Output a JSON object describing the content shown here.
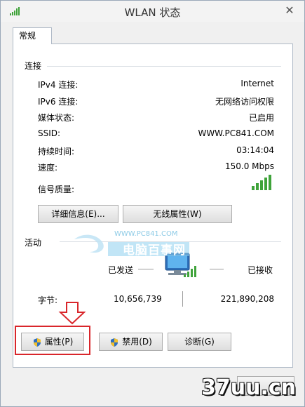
{
  "window": {
    "title": "WLAN 状态",
    "close_glyph": "✕"
  },
  "tabs": [
    {
      "label": "常规"
    }
  ],
  "connection": {
    "section_title": "连接",
    "rows": [
      {
        "label": "IPv4 连接:",
        "value": "Internet"
      },
      {
        "label": "IPv6 连接:",
        "value": "无网络访问权限"
      },
      {
        "label": "媒体状态:",
        "value": "已启用"
      },
      {
        "label": "SSID:",
        "value": "WWW.PC841.COM"
      },
      {
        "label": "持续时间:",
        "value": "03:14:04"
      },
      {
        "label": "速度:",
        "value": "150.0 Mbps"
      }
    ],
    "signal_label": "信号质量:",
    "signal_bars": 5,
    "buttons": {
      "details": "详细信息(E)...",
      "wireless_props": "无线属性(W)"
    }
  },
  "activity": {
    "section_title": "活动",
    "sent_label": "已发送",
    "received_label": "已接收",
    "bytes_label": "字节:",
    "sent_bytes": "10,656,739",
    "received_bytes": "221,890,208"
  },
  "bottom_buttons": {
    "properties": "属性(P)",
    "disable": "禁用(D)",
    "diagnose": "诊断(G)"
  },
  "watermarks": {
    "site_url": "WWW.PC841.COM",
    "site_name": "电脑百事网",
    "corner": "37uu.cn"
  },
  "colors": {
    "accent_red": "#d9262b",
    "signal_green": "#3fa33a"
  }
}
